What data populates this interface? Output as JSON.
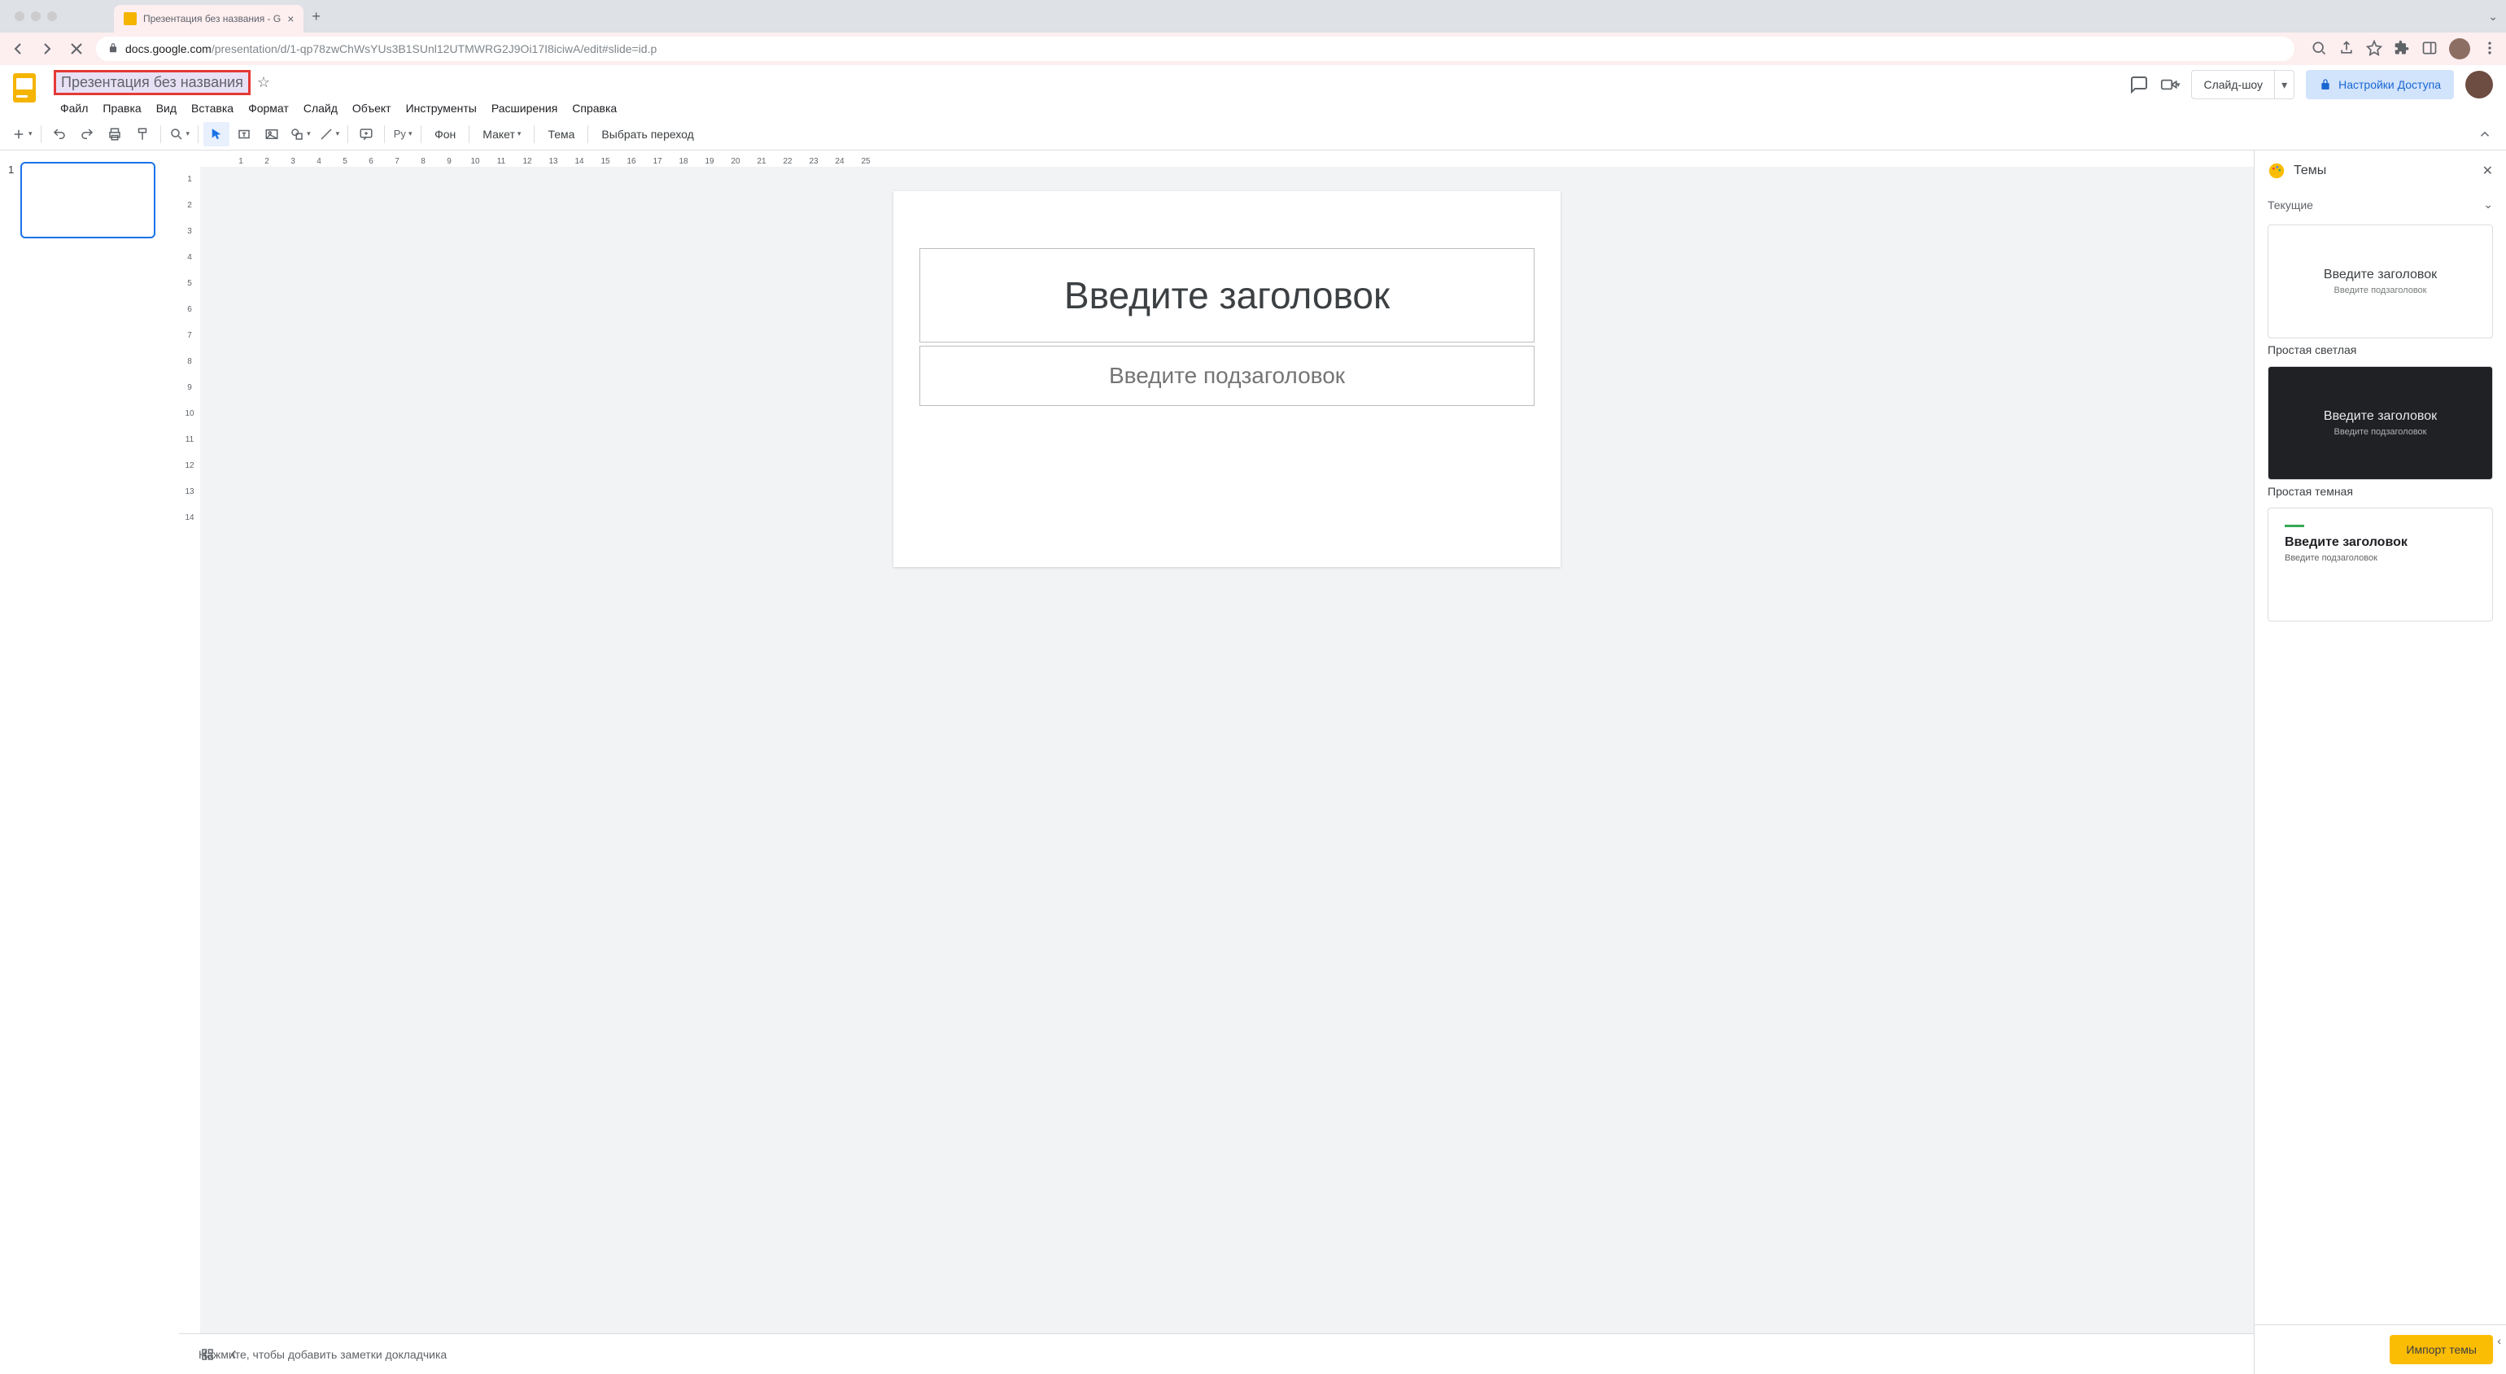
{
  "browser": {
    "tab_title": "Презентация без названия - G",
    "url_host": "docs.google.com",
    "url_path": "/presentation/d/1-qp78zwChWsYUs3B1SUnl12UTMWRG2J9Oi17I8iciwA/edit#slide=id.p"
  },
  "doc": {
    "title": "Презентация без названия"
  },
  "menubar": [
    "Файл",
    "Правка",
    "Вид",
    "Вставка",
    "Формат",
    "Слайд",
    "Объект",
    "Инструменты",
    "Расширения",
    "Справка"
  ],
  "header_buttons": {
    "slideshow": "Слайд-шоу",
    "share": "Настройки Доступа"
  },
  "toolbar": {
    "py": "Pу",
    "bg": "Фон",
    "layout": "Макет",
    "theme": "Тема",
    "transition": "Выбрать переход"
  },
  "filmstrip": {
    "slide_num": "1"
  },
  "slide": {
    "title_placeholder": "Введите заголовок",
    "subtitle_placeholder": "Введите подзаголовок"
  },
  "notes": {
    "placeholder": "Нажмите, чтобы добавить заметки докладчика"
  },
  "themes_panel": {
    "title": "Темы",
    "current": "Текущие",
    "items": [
      {
        "title": "Введите заголовок",
        "sub": "Введите подзаголовок",
        "name": "Простая светлая"
      },
      {
        "title": "Введите заголовок",
        "sub": "Введите подзаголовок",
        "name": "Простая темная"
      },
      {
        "title": "Введите заголовок",
        "sub": "Введите подзаголовок",
        "name": ""
      }
    ],
    "import": "Импорт темы"
  },
  "ruler_h": [
    "1",
    "2",
    "3",
    "4",
    "5",
    "6",
    "7",
    "8",
    "9",
    "10",
    "11",
    "12",
    "13",
    "14",
    "15",
    "16",
    "17",
    "18",
    "19",
    "20",
    "21",
    "22",
    "23",
    "24",
    "25"
  ],
  "ruler_v": [
    "1",
    "2",
    "3",
    "4",
    "5",
    "6",
    "7",
    "8",
    "9",
    "10",
    "11",
    "12",
    "13",
    "14"
  ]
}
